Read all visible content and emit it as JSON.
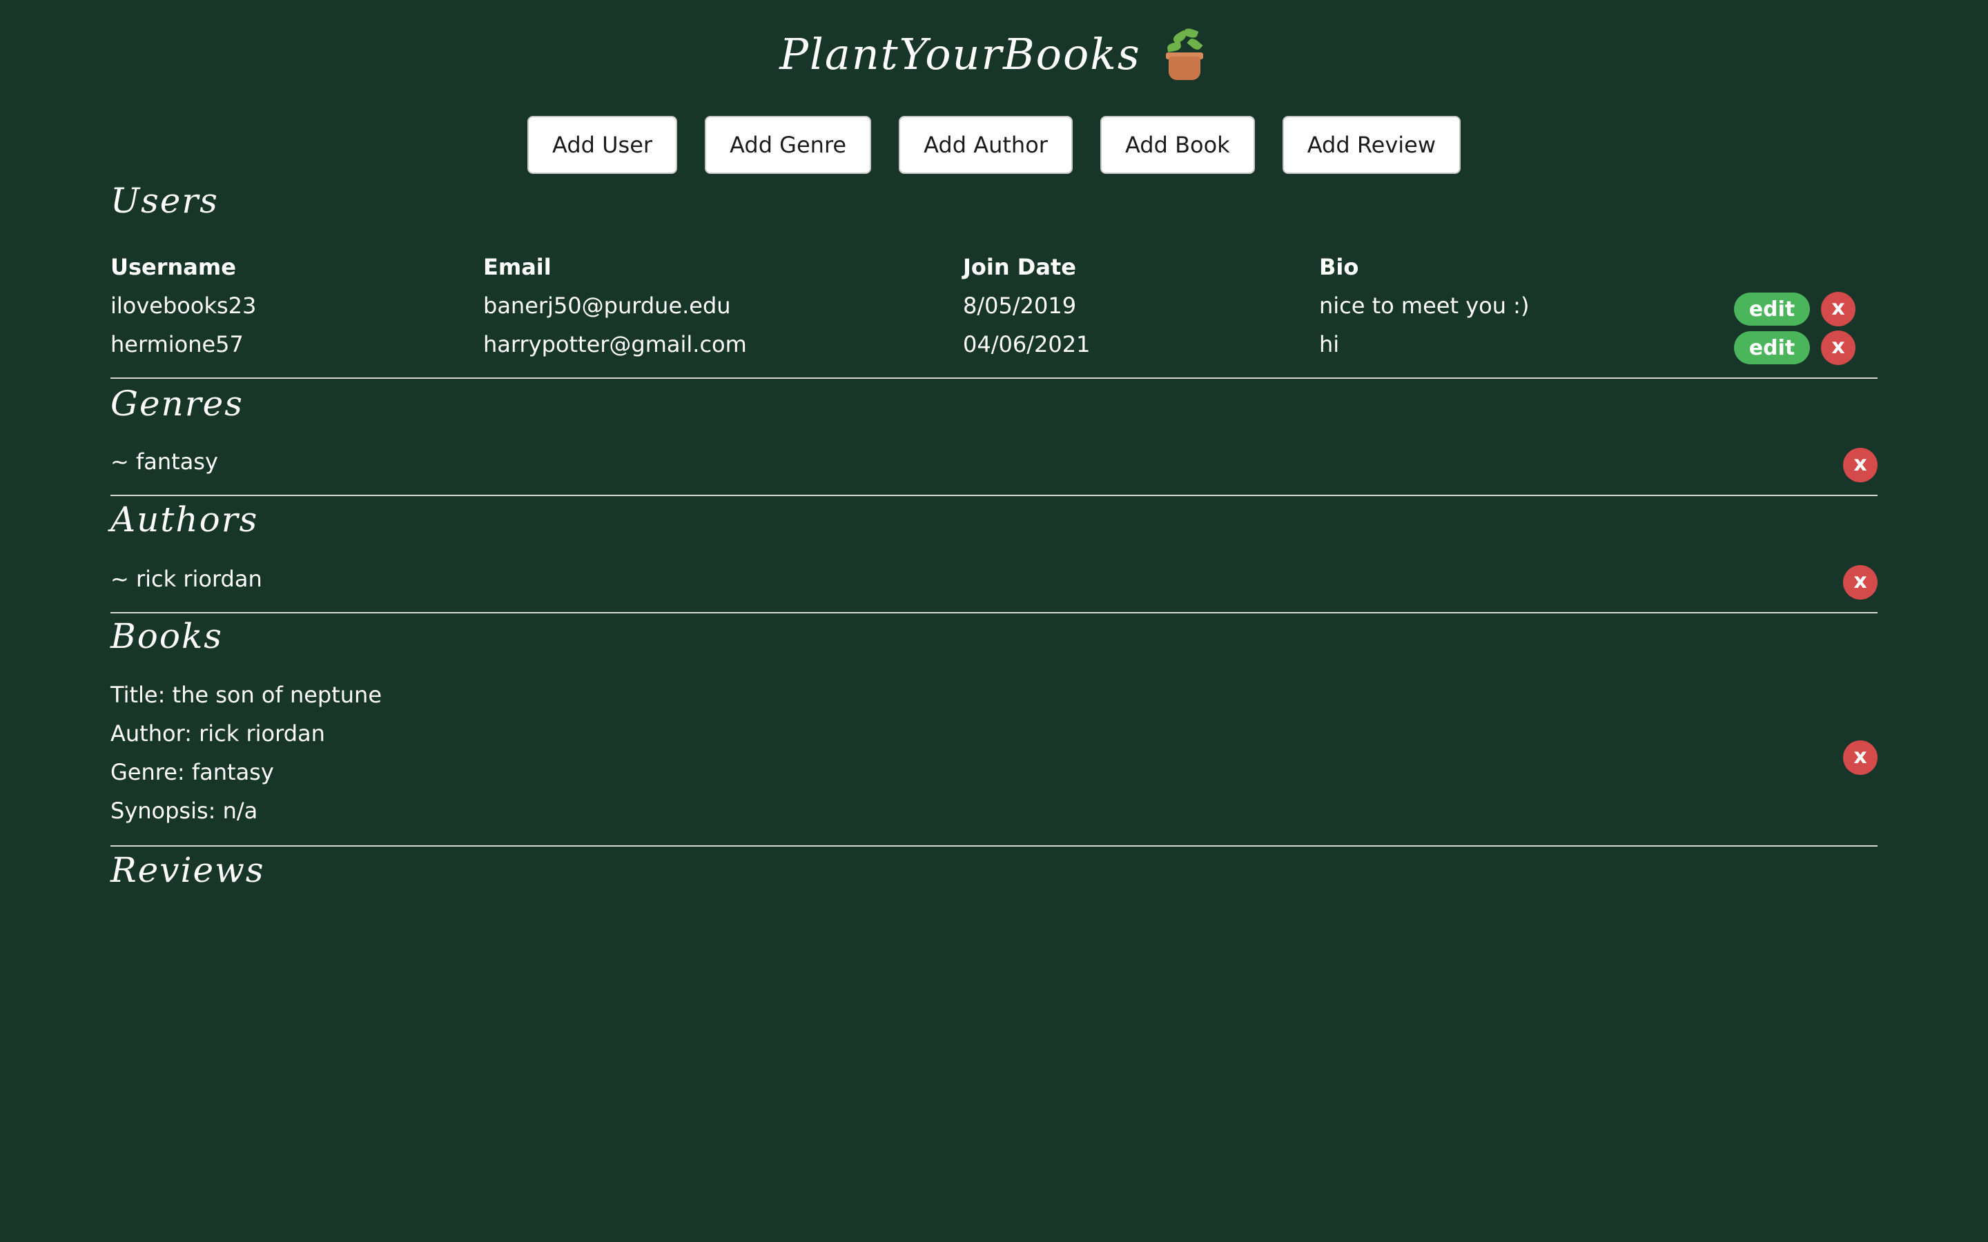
{
  "app": {
    "title": "PlantYourBooks",
    "logo_icon": "potted-plant-icon"
  },
  "toolbar": {
    "buttons": [
      "Add User",
      "Add Genre",
      "Add Author",
      "Add Book",
      "Add Review"
    ]
  },
  "sections": {
    "users": "Users",
    "genres": "Genres",
    "authors": "Authors",
    "books": "Books",
    "reviews": "Reviews"
  },
  "users": {
    "columns": [
      "Username",
      "Email",
      "Join Date",
      "Bio"
    ],
    "rows": [
      {
        "username": "ilovebooks23",
        "email": "banerj50@purdue.edu",
        "join_date": "8/05/2019",
        "bio": "nice to meet you :)"
      },
      {
        "username": "hermione57",
        "email": "harrypotter@gmail.com",
        "join_date": "04/06/2021",
        "bio": "hi"
      }
    ],
    "edit_label": "edit",
    "delete_label": "x"
  },
  "genres": {
    "items": [
      "~ fantasy"
    ],
    "delete_label": "x"
  },
  "authors": {
    "items": [
      "~ rick riordan"
    ],
    "delete_label": "x"
  },
  "books": {
    "items": [
      {
        "title": "Title: the son of neptune",
        "author": "Author: rick riordan",
        "genre": "Genre: fantasy",
        "synopsis": "Synopsis: n/a"
      }
    ],
    "delete_label": "x"
  },
  "colors": {
    "background": "#18352a",
    "edit": "#4bb55c",
    "delete": "#d54a4a"
  }
}
